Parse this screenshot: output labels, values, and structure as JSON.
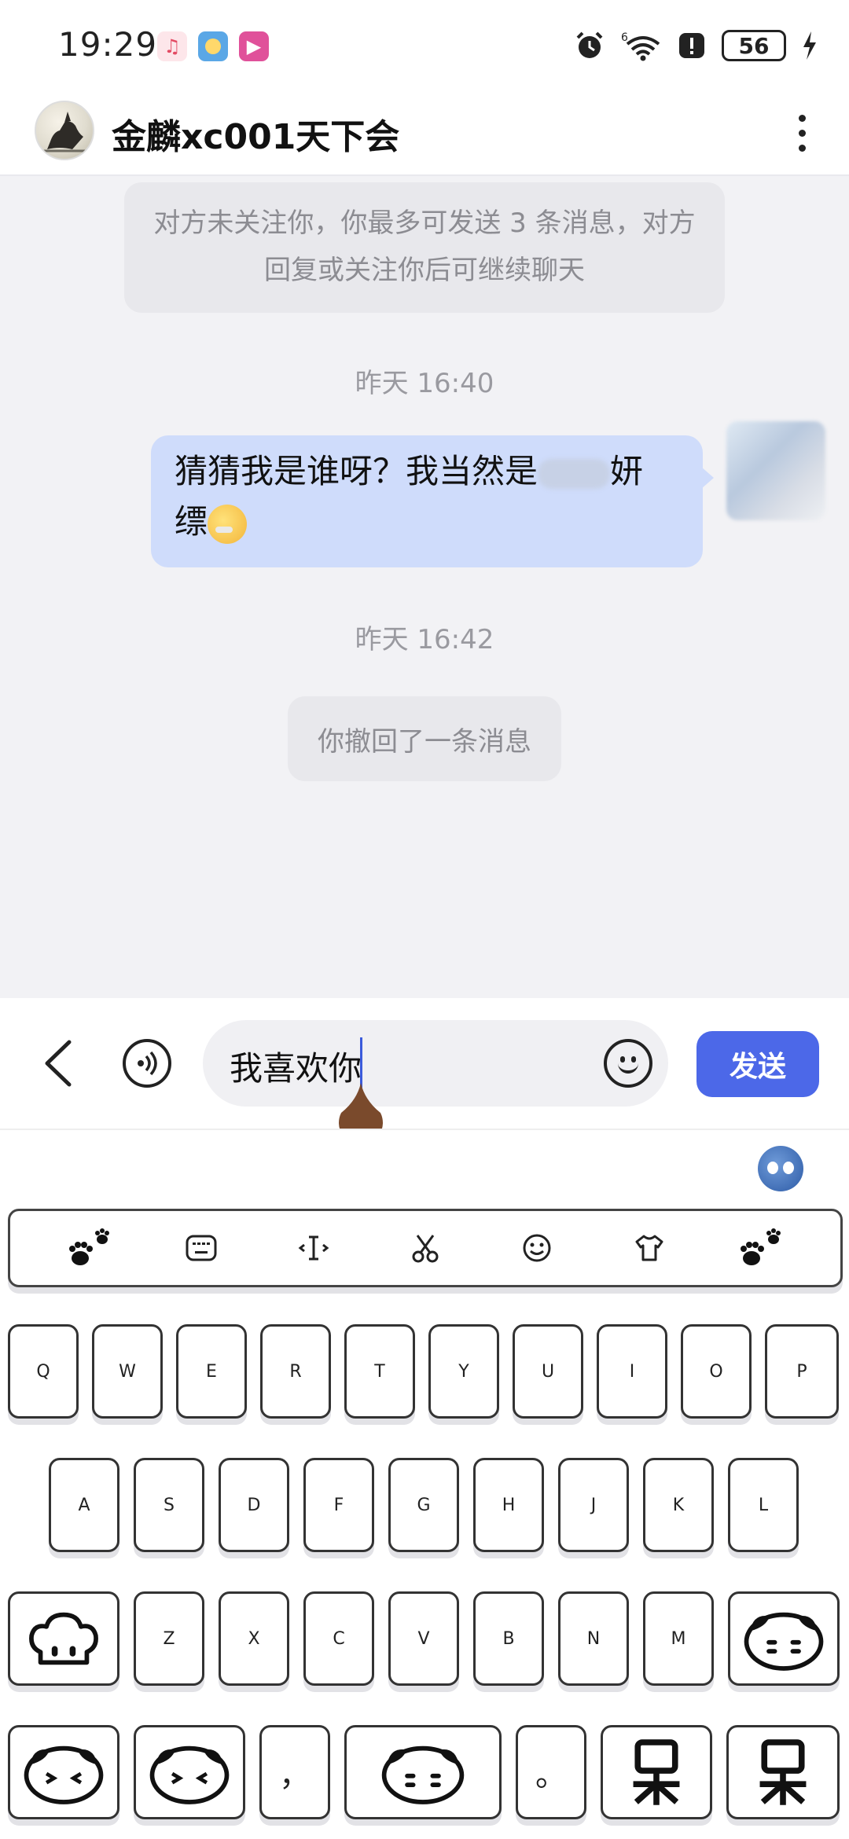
{
  "status_bar": {
    "time": "19:29",
    "battery": "56",
    "network": "6"
  },
  "header": {
    "title": "金麟xc001天下会"
  },
  "chat": {
    "notice_line1": "对方未关注你，你最多可发送 3 条消息，对方",
    "notice_line2": "回复或关注你后可继续聊天",
    "time1": "昨天 16:40",
    "message_line1_start": "猜猜我是谁呀？我当然是",
    "message_line1_end": "妍",
    "message_line2": "缥",
    "time2": "昨天 16:42",
    "recall_notice": "你撤回了一条消息"
  },
  "input_bar": {
    "input_value": "我喜欢你",
    "send_label": "发送"
  },
  "keyboard": {
    "row1": [
      "Q",
      "W",
      "E",
      "R",
      "T",
      "Y",
      "U",
      "I",
      "O",
      "P"
    ],
    "row2": [
      "A",
      "S",
      "D",
      "F",
      "G",
      "H",
      "J",
      "K",
      "L"
    ],
    "row3": [
      "Z",
      "X",
      "C",
      "V",
      "B",
      "N",
      "M"
    ],
    "comma": "，",
    "period": "。"
  },
  "colors": {
    "accent": "#4c68e8",
    "bubble": "#cfdcfb",
    "chat_bg": "#f2f2f5"
  }
}
